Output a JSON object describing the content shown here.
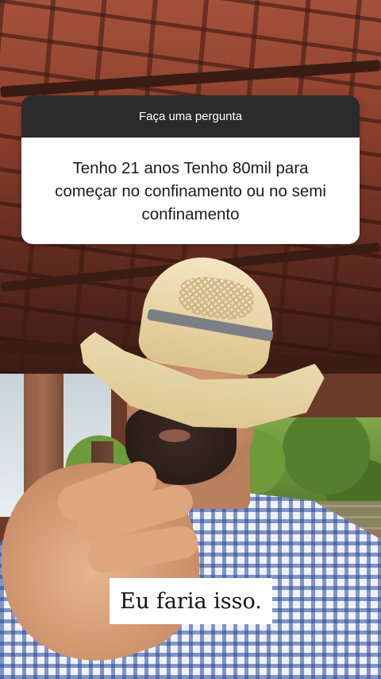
{
  "question_sticker": {
    "header": "Faça uma pergunta",
    "question": "Tenho 21 anos Tenho  80mil para começar  no confinamento ou no semi confinamento"
  },
  "caption": {
    "text": "Eu faria isso."
  },
  "colors": {
    "sticker_header_bg": "#2b2b2b",
    "sticker_body_bg": "#ffffff",
    "caption_bg": "#ffffff"
  }
}
